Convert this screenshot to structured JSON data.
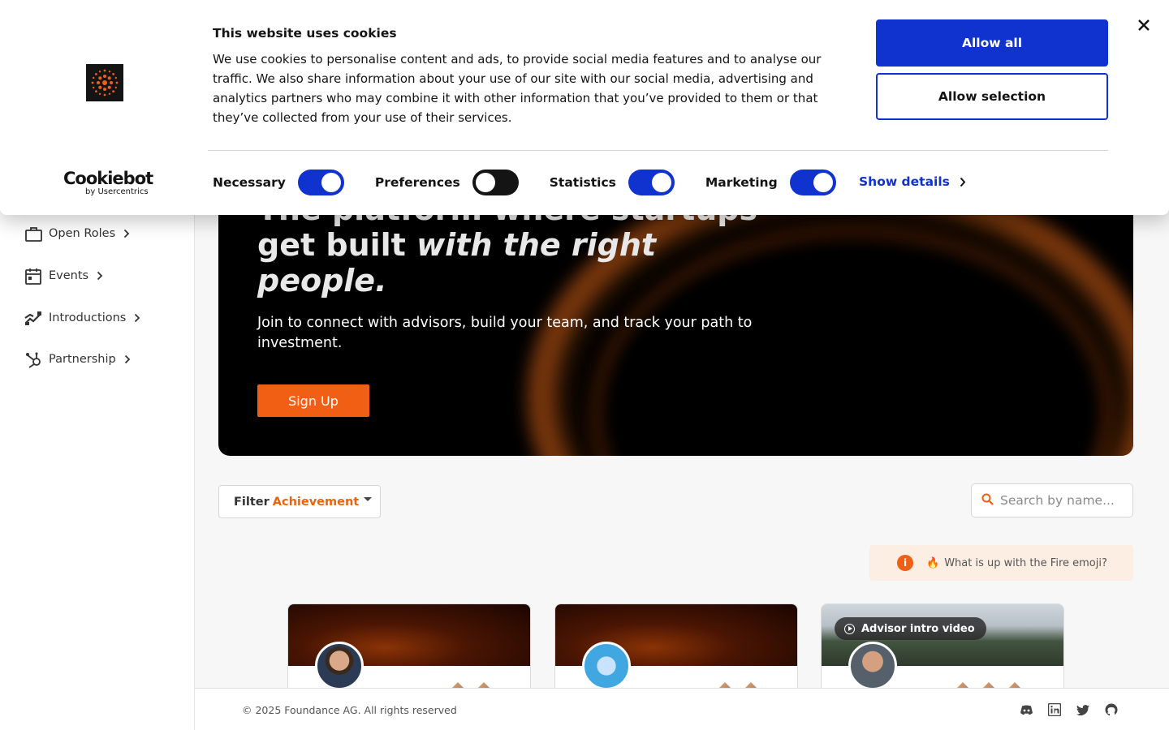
{
  "cookie_banner": {
    "title": "This website uses cookies",
    "text": "We use cookies to personalise content and ads, to provide social media features and to analyse our traffic. We also share information about your use of our site with our social media, advertising and analytics partners who may combine it with other information that you’ve provided to them or that they’ve collected from your use of their services.",
    "allow_all_label": "Allow all",
    "allow_selection_label": "Allow selection",
    "brand_name": "Cookiebot",
    "brand_sub": "by Usercentrics",
    "toggles": [
      {
        "label": "Necessary",
        "on": true
      },
      {
        "label": "Preferences",
        "on": false
      },
      {
        "label": "Statistics",
        "on": true
      },
      {
        "label": "Marketing",
        "on": true
      }
    ],
    "show_details_label": "Show details",
    "accent_color": "#1032cf"
  },
  "sidebar": {
    "items": [
      {
        "label": "Open Roles",
        "icon": "briefcase-icon"
      },
      {
        "label": "Events",
        "icon": "calendar-icon"
      },
      {
        "label": "Introductions",
        "icon": "handshake-icon"
      },
      {
        "label": "Partnership",
        "icon": "hubspot-icon"
      }
    ]
  },
  "hero": {
    "heading_line1": "The platform where startups",
    "heading_line2_plain": "get built ",
    "heading_line2_em": "with the right",
    "heading_line3_em": "people.",
    "subtext": "Join to connect with advisors, build your team, and track your path to investment.",
    "signup_label": "Sign Up",
    "brand_color": "#f05f14"
  },
  "filter": {
    "label": "Filter",
    "value": "Achievement"
  },
  "search": {
    "placeholder": "Search by name..."
  },
  "fire_info": {
    "text": "What is up with the Fire emoji?"
  },
  "cards": [
    {
      "avatar": "advisor-photo-1",
      "badges": 2
    },
    {
      "avatar": "robot-avatar",
      "badges": 2
    },
    {
      "avatar": "advisor-photo-2",
      "badges": 3,
      "intro_label": "Advisor intro video"
    }
  ],
  "footer": {
    "copyright": "© 2025 Foundance AG. All rights reserved",
    "social": [
      "discord-icon",
      "linkedin-icon",
      "twitter-icon",
      "github-icon"
    ]
  }
}
